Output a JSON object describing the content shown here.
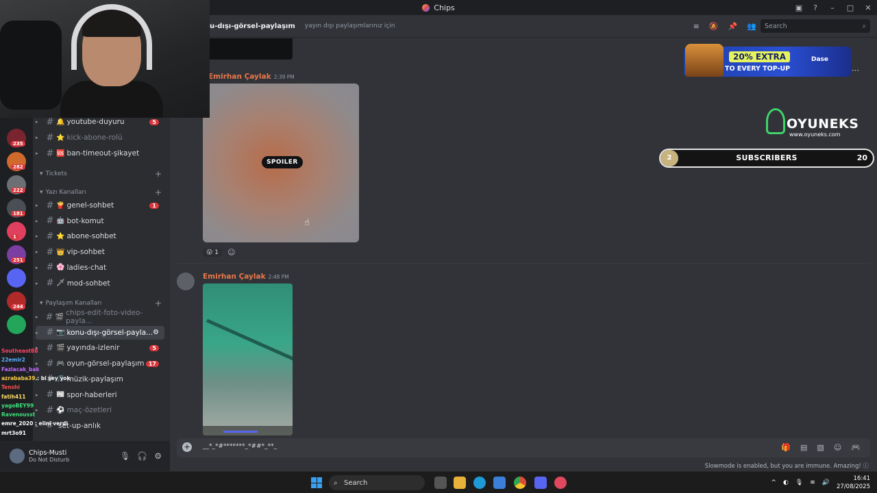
{
  "app": {
    "title": "Chips"
  },
  "channel_header": {
    "name": "u-dışı-görsel-paylaşım",
    "topic": "yayın dışı paylaşımlarınız için",
    "search_placeholder": "Search"
  },
  "servers": [
    {
      "badge": "235",
      "color": "#7a2430"
    },
    {
      "badge": "282",
      "color": "#d06a2c"
    },
    {
      "badge": "222",
      "color": "#6c7075"
    },
    {
      "badge": "181",
      "color": "#4a4e55"
    },
    {
      "badge": "1",
      "color": "#e04060"
    },
    {
      "badge": "251",
      "color": "#7a3fa0"
    },
    {
      "badge": "",
      "color": "#5865f2"
    },
    {
      "badge": "244",
      "color": "#b02a2a"
    },
    {
      "badge": "",
      "color": "#23a55a"
    }
  ],
  "sidebar": {
    "channels_top": [
      {
        "label": "youtube-duyuru",
        "emoji": "🔔",
        "badge": "5"
      },
      {
        "label": "kick-abone-rolü",
        "emoji": "⭐",
        "badge": "",
        "muted": true
      },
      {
        "label": "ban-timeout-şikayet",
        "emoji": "🆘",
        "badge": ""
      }
    ],
    "cat_tickets": "Tickets",
    "cat_text": "Yazı Kanalları",
    "channels_text": [
      {
        "label": "genel-sohbet",
        "emoji": "🍟",
        "badge": "1"
      },
      {
        "label": "bot-komut",
        "emoji": "🤖",
        "badge": ""
      },
      {
        "label": "abone-sohbet",
        "emoji": "⭐",
        "badge": ""
      },
      {
        "label": "vip-sohbet",
        "emoji": "👑",
        "badge": ""
      },
      {
        "label": "ladies-chat",
        "emoji": "🌸",
        "badge": ""
      },
      {
        "label": "mod-sohbet",
        "emoji": "🗡",
        "badge": ""
      }
    ],
    "cat_share": "Paylaşım Kanalları",
    "channels_share": [
      {
        "label": "chips-edit-foto-video-payla...",
        "emoji": "🎬",
        "badge": "",
        "muted": true
      },
      {
        "label": "konu-dışı-görsel-payla...",
        "emoji": "📷",
        "badge": "",
        "active": true
      },
      {
        "label": "yayında-izlenir",
        "emoji": "🎬",
        "badge": "5"
      },
      {
        "label": "oyun-görsel-paylaşım",
        "emoji": "🎮",
        "badge": "17"
      },
      {
        "label": "müzik-paylaşım",
        "emoji": "🎵",
        "badge": ""
      },
      {
        "label": "spor-haberleri",
        "emoji": "📰",
        "badge": ""
      },
      {
        "label": "maç-özetleri",
        "emoji": "⚽",
        "badge": "",
        "muted": true
      },
      {
        "label": "set-up-anlık",
        "emoji": "",
        "badge": ""
      }
    ]
  },
  "user": {
    "name": "Chips-Musti",
    "status": "Do Not Disturb"
  },
  "messages": [
    {
      "author": "Emirhan Çaylak",
      "time": "2:39 PM",
      "spoiler_label": "SPOILER",
      "reaction_count": "1"
    },
    {
      "author": "Emirhan Çaylak",
      "time": "2:48 PM"
    }
  ],
  "composer": {
    "text": "__*_*#*******_*##*_**_"
  },
  "slowmode": "Slowmode is enabled, but you are immune. Amazing!",
  "overlays": {
    "promo": {
      "headline": "20% EXTRA",
      "subline": "TO EVERY TOP-UP",
      "brand": "Dase"
    },
    "oyuneks": {
      "name": "OYUNEKS",
      "url": "www.oyuneks.com"
    },
    "subgoal": {
      "current": "2",
      "label": "SUBSCRIBERS",
      "goal": "20",
      "progress_fraction": 0.1
    },
    "stream_chat": [
      {
        "user": "Southeast88",
        "text": "",
        "color": "#ff4466"
      },
      {
        "user": "22emir2",
        "text": "",
        "color": "#5ab0ff"
      },
      {
        "user": "Fazlacak_bak",
        "text": "",
        "color": "#c06cff"
      },
      {
        "user": "azrababa39",
        "text": "bi şey yok",
        "color": "#ffd24a"
      },
      {
        "user": "Tenshi",
        "text": "",
        "color": "#ff4f4f"
      },
      {
        "user": "fatih411",
        "text": "",
        "color": "#ffe066"
      },
      {
        "user": "yagoBEY99",
        "text": "",
        "color": "#3ee07a"
      },
      {
        "user": "Ravenousst",
        "text": "",
        "color": "#3ee07a"
      },
      {
        "user": "emre_2020",
        "text": "elini verdi",
        "color": "#ffffff"
      },
      {
        "user": "mrt3o91",
        "text": "",
        "color": "#ffffff"
      }
    ]
  },
  "taskbar": {
    "search_label": "Search",
    "time": "16:41",
    "date": "27/08/2025"
  }
}
